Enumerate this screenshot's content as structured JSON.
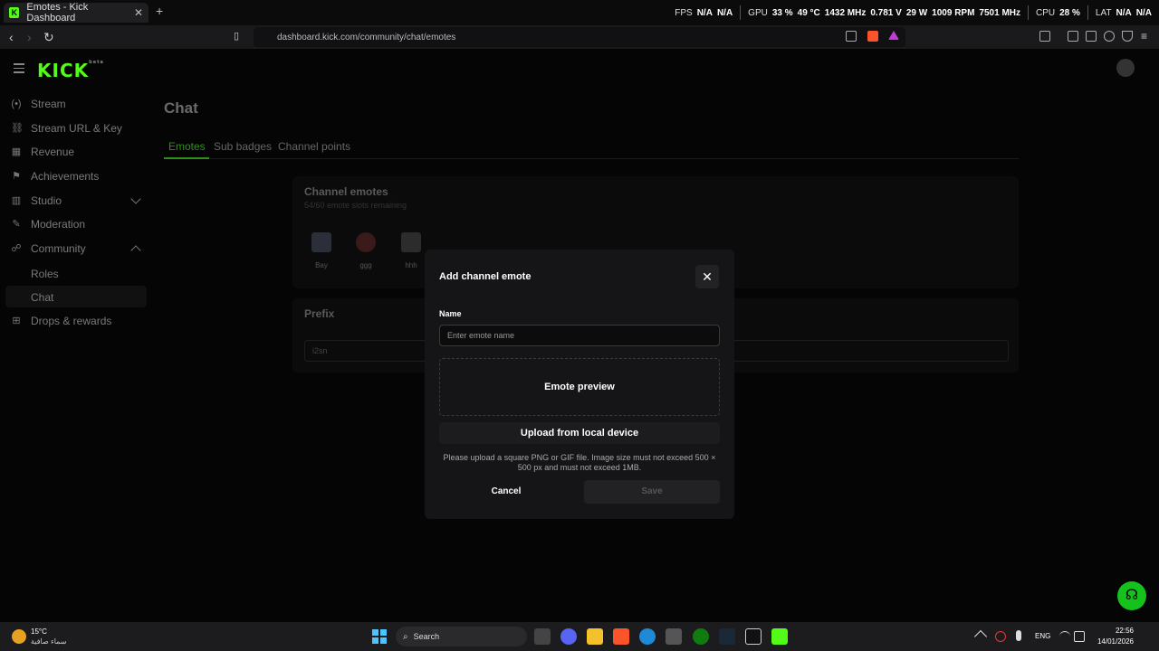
{
  "browser": {
    "tab_title": "Emotes - Kick Dashboard",
    "tab_close": "✕",
    "new_tab": "+",
    "url": "dashboard.kick.com/community/chat/emotes",
    "osd": {
      "fps_label": "FPS",
      "fps_val1": "N/A",
      "fps_val2": "N/A",
      "gpu_label": "GPU",
      "gpu_util": "33 %",
      "gpu_temp": "49 °C",
      "gpu_clock": "1432 MHz",
      "gpu_volt": "0.781 V",
      "gpu_power": "29 W",
      "gpu_fan": "1009 RPM",
      "gpu_mem": "7501 MHz",
      "cpu_label": "CPU",
      "cpu_util": "28 %",
      "lat_label": "LAT",
      "lat_val1": "N/A",
      "lat_val2": "N/A"
    }
  },
  "app": {
    "logo": "KICK",
    "logo_beta": "beta"
  },
  "sidebar": {
    "items": [
      {
        "label": "Stream",
        "icon": "(•)"
      },
      {
        "label": "Stream URL & Key",
        "icon": "⛓"
      },
      {
        "label": "Revenue",
        "icon": "▦"
      },
      {
        "label": "Achievements",
        "icon": "⚑"
      },
      {
        "label": "Studio",
        "icon": "▥"
      },
      {
        "label": "Moderation",
        "icon": "✎"
      },
      {
        "label": "Community",
        "icon": "☍"
      },
      {
        "label": "Drops & rewards",
        "icon": "⊞"
      }
    ],
    "subitems": [
      "Roles",
      "Chat"
    ]
  },
  "main": {
    "title": "Chat",
    "tabs": [
      "Emotes",
      "Sub badges",
      "Channel points"
    ],
    "channel_emotes": {
      "title": "Channel emotes",
      "subtitle": "54/60 emote slots remaining",
      "emotes": [
        "Bay",
        "ggg",
        "hhh"
      ]
    },
    "prefix": {
      "title": "Prefix",
      "value": "i2sn"
    }
  },
  "modal": {
    "title": "Add channel emote",
    "close": "✕",
    "name_label": "Name",
    "name_placeholder": "Enter emote name",
    "preview_label": "Emote preview",
    "upload_label": "Upload from local device",
    "hint": "Please upload a square PNG or GIF file. Image size must not exceed 500 × 500 px and must not exceed 1MB.",
    "cancel_label": "Cancel",
    "save_label": "Save"
  },
  "taskbar": {
    "temp": "15°C",
    "weather": "سماء صافية",
    "search": "Search",
    "lang": "ENG",
    "time": "22:56",
    "date": "14/01/2026"
  }
}
